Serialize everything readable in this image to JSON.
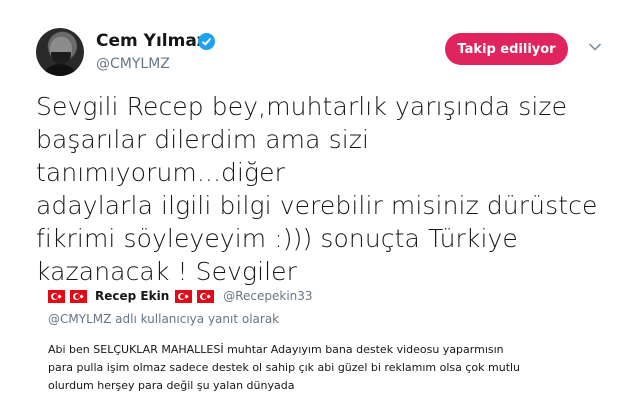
{
  "author": {
    "name": "Cem Yılmaz",
    "handle": "@CMYLMZ",
    "follow_label": "Takip ediliyor"
  },
  "tweet": {
    "lines": [
      "Sevgili Recep bey,muhtarlık yarışında size",
      "başarılar dilerdim ama sizi tanımıyorum...diğer",
      "adaylarla ilgili bilgi verebilir misiniz dürüstce",
      "fikrimi söyleyeyim :))) sonuçta Türkiye",
      "kazanacak ! Sevgiler"
    ]
  },
  "quoted": {
    "name": "Recep Ekin",
    "handle": "@Recepekin33",
    "reply_to": "@CMYLMZ adlı kullanıcıya yanıt olarak",
    "body_lines": [
      "Abi ben SELÇUKLAR MAHALLESİ muhtar Adayıyım bana destek videosu yaparmısın",
      "para pulla işim olmaz sadece destek ol sahip çık abi güzel bi reklamım olsa çok mutlu",
      "olurdum herşey para değil şu yalan dünyada"
    ]
  },
  "colors": {
    "follow_button": "#e0245e",
    "verified_badge": "#1da1f2",
    "secondary_text": "#657786",
    "flag_red": "#e30a17"
  },
  "icons": [
    "verified-badge-icon",
    "chevron-down-icon",
    "turkey-flag-icon"
  ]
}
